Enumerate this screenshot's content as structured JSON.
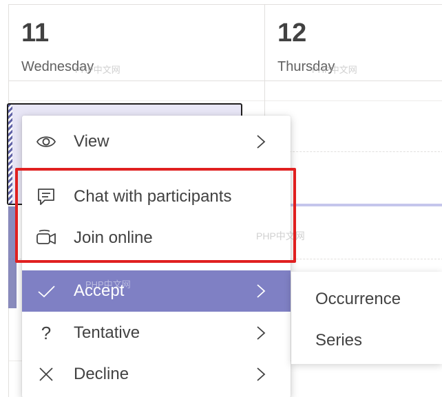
{
  "calendar": {
    "days": [
      {
        "number": "11",
        "name": "Wednesday",
        "watermark": "PHP中文网"
      },
      {
        "number": "12",
        "name": "Thursday",
        "watermark": "PHP中文网"
      }
    ]
  },
  "context_menu": {
    "items": [
      {
        "label": "View",
        "icon": "eye-icon",
        "has_submenu": true
      },
      {
        "label": "Chat with participants",
        "icon": "chat-icon",
        "has_submenu": false
      },
      {
        "label": "Join online",
        "icon": "video-camera-icon",
        "has_submenu": false
      },
      {
        "label": "Accept",
        "icon": "checkmark-icon",
        "has_submenu": true,
        "active": true
      },
      {
        "label": "Tentative",
        "icon": "question-icon",
        "has_submenu": true
      },
      {
        "label": "Decline",
        "icon": "close-icon",
        "has_submenu": true
      }
    ],
    "highlight_color": "#e02020",
    "active_color": "#7f80c4"
  },
  "submenu": {
    "items": [
      {
        "label": "Occurrence"
      },
      {
        "label": "Series"
      }
    ]
  },
  "watermarks": {
    "center": "PHP中文网",
    "accept": "PHP中文网"
  }
}
